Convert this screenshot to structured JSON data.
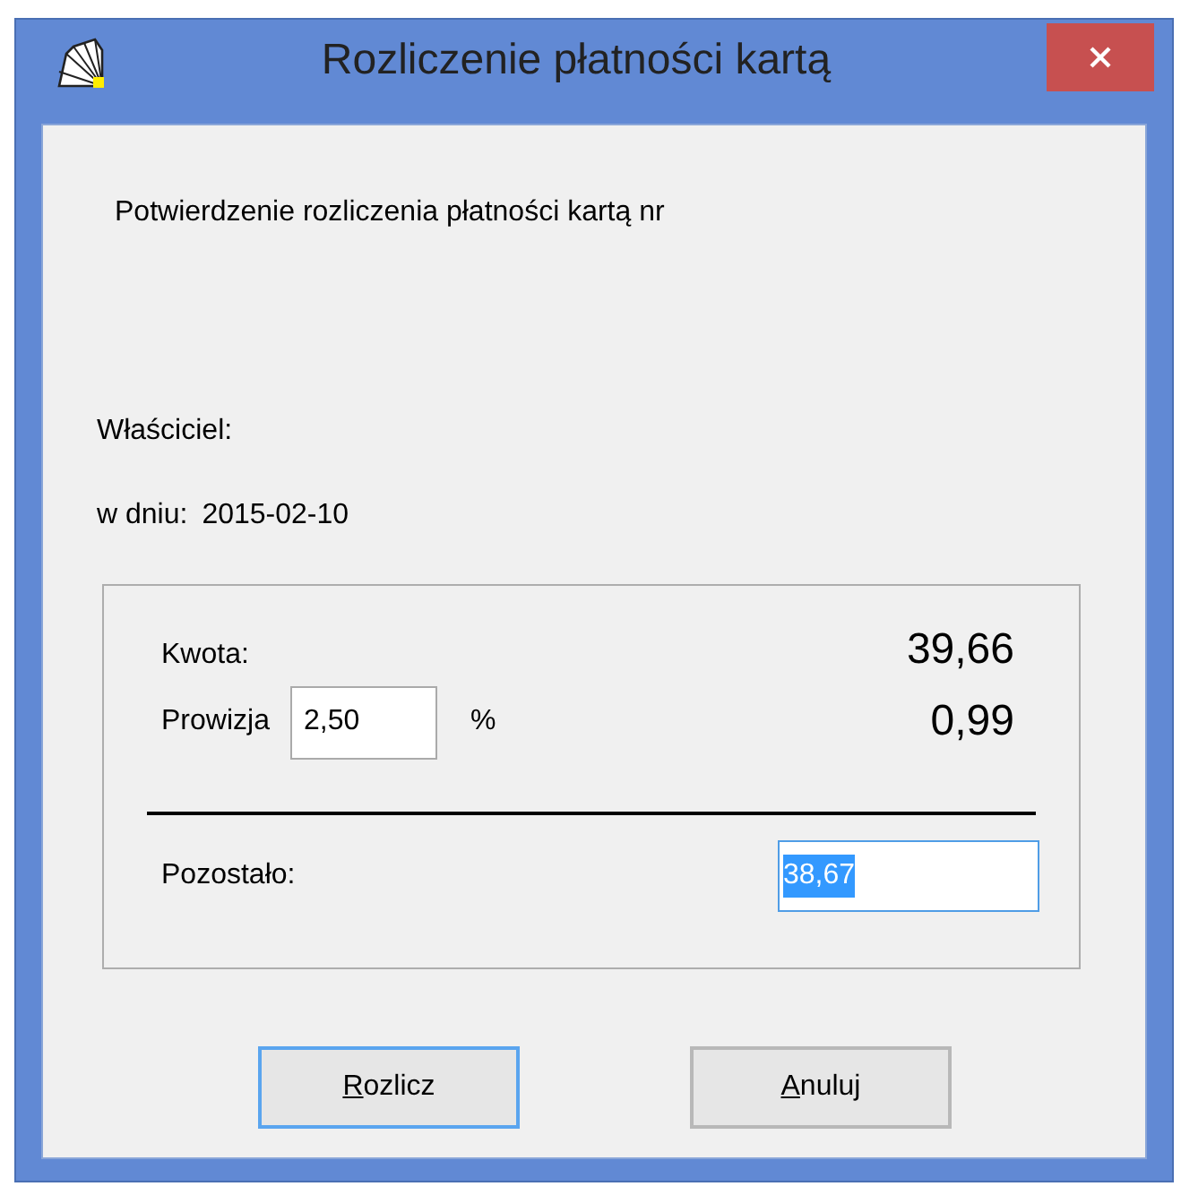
{
  "window": {
    "title": "Rozliczenie płatności kartą"
  },
  "confirmation": "Potwierdzenie rozliczenia płatności kartą nr",
  "owner_label": "Właściciel:",
  "date_label": "w dniu:",
  "date": "2015-02-10",
  "amount": {
    "label": "Kwota:",
    "value": "39,66"
  },
  "commission": {
    "label": "Prowizja",
    "rate": "2,50",
    "unit": "%",
    "value": "0,99"
  },
  "remaining": {
    "label": "Pozostało:",
    "value": "38,67",
    "text_selected": true
  },
  "buttons": [
    {
      "label": "Rozlicz",
      "focused": true,
      "mnemonic_underlined": true
    },
    {
      "label": "Anuluj",
      "focused": false,
      "mnemonic_underlined": true
    }
  ]
}
